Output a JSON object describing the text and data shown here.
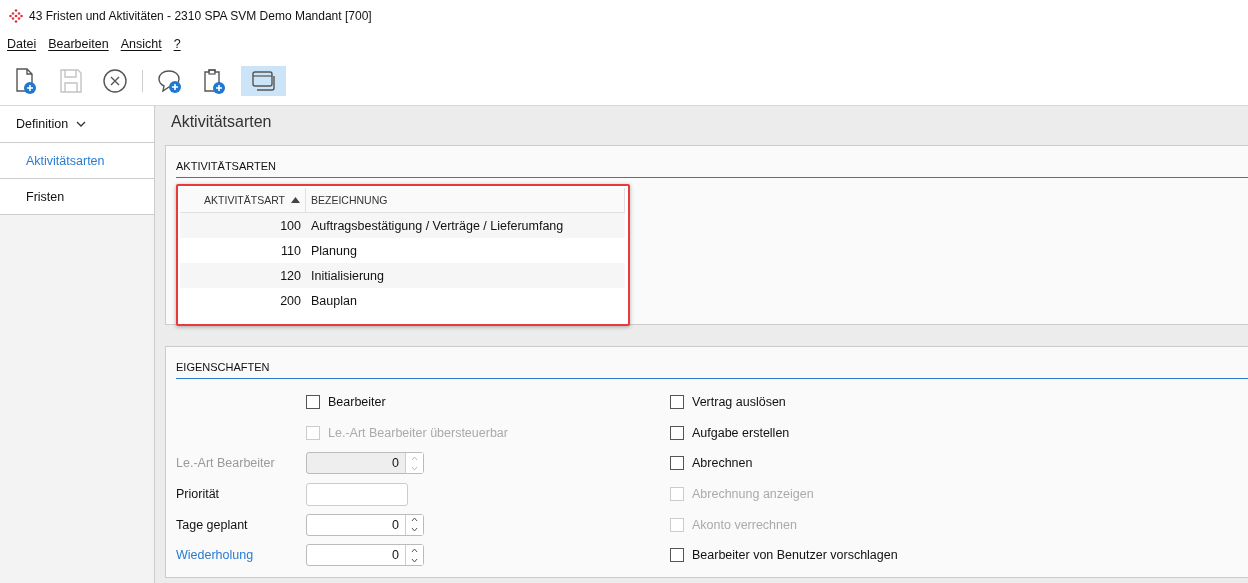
{
  "window": {
    "title": "43 Fristen und Aktivitäten - 2310 SPA SVM Demo Mandant [700]"
  },
  "menu": [
    "Datei",
    "Bearbeiten",
    "Ansicht",
    "?"
  ],
  "toolbar": [
    [
      {
        "kind": "new-document",
        "disabled": false,
        "selected": false
      },
      {
        "kind": "save",
        "disabled": true,
        "selected": false
      },
      {
        "kind": "cancel",
        "disabled": false,
        "selected": false
      }
    ],
    [
      {
        "kind": "add-comment",
        "disabled": false,
        "selected": false
      },
      {
        "kind": "add-clipboard",
        "disabled": false,
        "selected": false
      },
      {
        "kind": "windows",
        "disabled": false,
        "selected": true
      }
    ]
  ],
  "sidebar": {
    "header": "Definition",
    "items": [
      {
        "label": "Aktivitätsarten",
        "selected": true
      },
      {
        "label": "Fristen",
        "selected": false
      }
    ]
  },
  "page_title": "Aktivitätsarten",
  "list_panel": {
    "title": "AKTIVITÄTSARTEN",
    "columns": [
      "AKTIVITÄTSART",
      "BEZEICHNUNG"
    ],
    "rows": [
      [
        "100",
        "Auftragsbestätigung / Verträge / Lieferumfang"
      ],
      [
        "110",
        "Planung"
      ],
      [
        "120",
        "Initialisierung"
      ],
      [
        "200",
        "Bauplan"
      ]
    ]
  },
  "properties": {
    "title": "EIGENSCHAFTEN",
    "left": [
      {
        "kind": "checkbox",
        "label": "Bearbeiter",
        "checked": false,
        "disabled": false
      },
      {
        "kind": "checkbox",
        "label": "Le.-Art Bearbeiter übersteuerbar",
        "checked": false,
        "disabled": true
      },
      {
        "kind": "spinner",
        "label": "Le.-Art Bearbeiter",
        "value": "0",
        "disabled": true,
        "link": false
      },
      {
        "kind": "text",
        "label": "Priorität",
        "disabled": false,
        "link": false
      },
      {
        "kind": "spinner",
        "label": "Tage geplant",
        "value": "0",
        "disabled": false,
        "link": false
      },
      {
        "kind": "spinner",
        "label": "Wiederholung",
        "value": "0",
        "disabled": false,
        "link": true
      }
    ],
    "right": [
      {
        "label": "Vertrag auslösen",
        "checked": false,
        "disabled": false
      },
      {
        "label": "Aufgabe erstellen",
        "checked": false,
        "disabled": false
      },
      {
        "label": "Abrechnen",
        "checked": false,
        "disabled": false
      },
      {
        "label": "Abrechnung anzeigen",
        "checked": false,
        "disabled": true
      },
      {
        "label": "Akonto verrechnen",
        "checked": false,
        "disabled": true
      },
      {
        "label": "Bearbeiter von Benutzer vorschlagen",
        "checked": false,
        "disabled": false
      }
    ]
  }
}
